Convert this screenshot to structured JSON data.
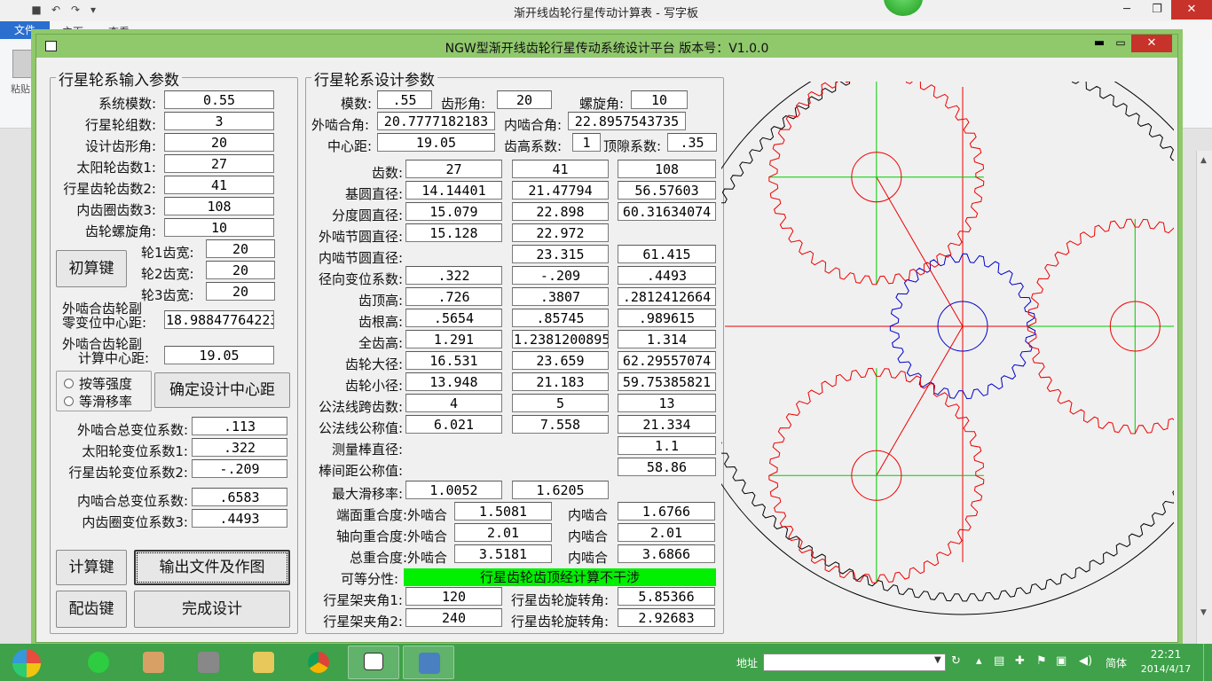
{
  "wordpad": {
    "title": "渐开线齿轮行星传动计算表 - 写字板",
    "file_tab": "文件",
    "tab_home": "主页",
    "tab_view": "查看",
    "paste_label": "粘贴"
  },
  "dialog": {
    "title": "NGW型渐开线齿轮行星传动系统设计平台  版本号：V1.0.0"
  },
  "input": {
    "group_title": "行星轮系输入参数",
    "module_label": "系统模数:",
    "module_value": "0.55",
    "groups_label": "行星轮组数:",
    "groups_value": "3",
    "pressure_angle_label": "设计齿形角:",
    "pressure_angle_value": "20",
    "z1_label": "太阳轮齿数1:",
    "z1_value": "27",
    "z2_label": "行星齿轮齿数2:",
    "z2_value": "41",
    "z3_label": "内齿圈齿数3:",
    "z3_value": "108",
    "helix_label": "齿轮螺旋角:",
    "helix_value": "10",
    "width1_label": "轮1齿宽:",
    "width1_value": "20",
    "width2_label": "轮2齿宽:",
    "width2_value": "20",
    "width3_label": "轮3齿宽:",
    "width3_value": "20",
    "init_button": "初算键",
    "ext_zero_cd_label_1": "外啮合齿轮副",
    "ext_zero_cd_label_2": "零变位中心距:",
    "ext_zero_cd_value": "18.98847764223",
    "ext_calc_cd_label_1": "外啮合齿轮副",
    "ext_calc_cd_label_2": "计算中心距:",
    "ext_calc_cd_value": "19.05",
    "radio_strength": "按等强度",
    "radio_sliding": "等滑移率",
    "confirm_cd_button": "确定设计中心距",
    "ext_total_shift_label": "外啮合总变位系数:",
    "ext_total_shift_value": ".113",
    "sun_shift_label": "太阳轮变位系数1:",
    "sun_shift_value": ".322",
    "planet_shift_label": "行星齿轮变位系数2:",
    "planet_shift_value": "-.209",
    "int_total_shift_label": "内啮合总变位系数:",
    "int_total_shift_value": ".6583",
    "ring_shift_label": "内齿圈变位系数3:",
    "ring_shift_value": ".4493",
    "calc_button": "计算键",
    "export_button": "输出文件及作图",
    "match_button": "配齿键",
    "finish_button": "完成设计"
  },
  "design": {
    "group_title": "行星轮系设计参数",
    "module_label": "模数:",
    "module_value": ".55",
    "pa_label": "齿形角:",
    "pa_value": "20",
    "helix_label": "螺旋角:",
    "helix_value": "10",
    "ext_angle_label": "外啮合角:",
    "ext_angle_value": "20.7777182183",
    "int_angle_label": "内啮合角:",
    "int_angle_value": "22.8957543735",
    "cd_label": "中心距:",
    "cd_value": "19.05",
    "addendum_coef_label": "齿高系数:",
    "addendum_coef_value": "1",
    "clearance_coef_label": "顶隙系数:",
    "clearance_coef_value": ".35",
    "rows": [
      {
        "label": "齿数:",
        "v1": "27",
        "v2": "41",
        "v3": "108"
      },
      {
        "label": "基圆直径:",
        "v1": "14.14401",
        "v2": "21.47794",
        "v3": "56.57603"
      },
      {
        "label": "分度圆直径:",
        "v1": "15.079",
        "v2": "22.898",
        "v3": "60.31634074"
      },
      {
        "label": "外啮节圆直径:",
        "v1": "15.128",
        "v2": "22.972",
        "v3": ""
      },
      {
        "label": "内啮节圆直径:",
        "v1": "",
        "v2": "23.315",
        "v3": "61.415"
      },
      {
        "label": "径向变位系数:",
        "v1": ".322",
        "v2": "-.209",
        "v3": ".4493"
      },
      {
        "label": "齿顶高:",
        "v1": ".726",
        "v2": ".3807",
        "v3": ".2812412664"
      },
      {
        "label": "齿根高:",
        "v1": ".5654",
        "v2": ".85745",
        "v3": ".989615"
      },
      {
        "label": "全齿高:",
        "v1": "1.291",
        "v2": "1.2381200895",
        "v3": "1.314"
      },
      {
        "label": "齿轮大径:",
        "v1": "16.531",
        "v2": "23.659",
        "v3": "62.29557074"
      },
      {
        "label": "齿轮小径:",
        "v1": "13.948",
        "v2": "21.183",
        "v3": "59.75385821"
      },
      {
        "label": "公法线跨齿数:",
        "v1": "4",
        "v2": "5",
        "v3": "13"
      },
      {
        "label": "公法线公称值:",
        "v1": "6.021",
        "v2": "7.558",
        "v3": "21.334"
      },
      {
        "label": "测量棒直径:",
        "v1": "",
        "v2": "",
        "v3": "1.1"
      },
      {
        "label": "棒间距公称值:",
        "v1": "",
        "v2": "",
        "v3": "58.86"
      }
    ],
    "slide_label": "最大滑移率:",
    "slide_v1": "1.0052",
    "slide_v2": "1.6205",
    "transverse_label": "端面重合度:外啮合",
    "transverse_ext": "1.5081",
    "transverse_int_label": "内啮合",
    "transverse_int": "1.6766",
    "axial_label": "轴向重合度:外啮合",
    "axial_ext": "2.01",
    "axial_int_label": "内啮合",
    "axial_int": "2.01",
    "total_label": "总重合度:外啮合",
    "total_ext": "3.5181",
    "total_int_label": "内啮合",
    "total_int": "3.6866",
    "equal_div_label": "可等分性:",
    "interference_text": "行星齿轮齿顶经计算不干涉",
    "carrier1_label": "行星架夹角1:",
    "carrier1_value": "120",
    "rot1_label": "行星齿轮旋转角:",
    "rot1_value": "5.85366",
    "carrier2_label": "行星架夹角2:",
    "carrier2_value": "240",
    "rot2_label": "行星齿轮旋转角:",
    "rot2_value": "2.92683",
    "colors": {
      "interference_ok": "#00f000"
    }
  },
  "taskbar": {
    "addr_label": "地址",
    "lang": "简体",
    "time": "22:21",
    "date": "2014/4/17"
  },
  "icons": [
    "start-orb-icon",
    "ie-icon",
    "paint-icon",
    "calculator-icon",
    "explorer-icon",
    "chrome-icon",
    "window-icon",
    "wordpad-icon"
  ]
}
